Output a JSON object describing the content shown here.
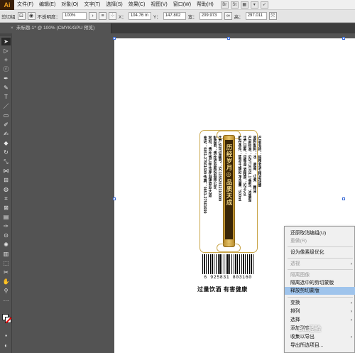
{
  "app": {
    "logo": "Ai"
  },
  "menubar": {
    "items": [
      "文件(F)",
      "编辑(E)",
      "对象(O)",
      "文字(T)",
      "选择(S)",
      "效果(C)",
      "视图(V)",
      "窗口(W)",
      "帮助(H)"
    ],
    "br_label": "Br",
    "st_label": "St"
  },
  "control": {
    "selection_label": "剪切组",
    "opacity_label": "不透明度：",
    "opacity_value": "100%",
    "x_label": "X：",
    "x_value": "104.76 m",
    "y_label": "Y：",
    "y_value": "147.802",
    "w_label": "宽：",
    "w_value": "209.973",
    "h_label": "高：",
    "h_value": "297.011"
  },
  "document": {
    "tab_label": "未标题-1* @ 100% (CMYK/GPU 预览)",
    "close": "×"
  },
  "artwork": {
    "ribbon_text": "历经岁月◎品质天成",
    "columns": [
      "产品名称：纯粮老酒·精品佳酿",
      "原料配料：水、高粱、小麦、糯米",
      "产品标准：GB/T10781.1 香型：浓香型",
      "生产日期：见瓶身 酒精度：52%vol",
      "贮存条件：阴凉干燥处 净含量：500ml",
      "生产许可证编号：SC11552032110099",
      "制造商：贵州酒业股份有限公司",
      "地址：贵州省仁怀市茅台镇酒业大道",
      "电话：0851-27561699 传真：0851-27561699"
    ],
    "barcode_number": "6 925831 803160",
    "warning": "过量饮酒  有害健康"
  },
  "context_menu": {
    "items": [
      {
        "label": "还原取消编组(U)",
        "enabled": true,
        "submenu": false
      },
      {
        "label": "重做(R)",
        "enabled": false,
        "submenu": false
      },
      {
        "label": "设为像素级优化",
        "enabled": true,
        "submenu": false
      },
      {
        "label": "透视",
        "enabled": false,
        "submenu": true
      },
      {
        "label": "隔离图像",
        "enabled": false,
        "submenu": false
      },
      {
        "label": "隔离选中的剪切蒙版",
        "enabled": true,
        "submenu": false
      },
      {
        "label": "释放剪切蒙版",
        "enabled": true,
        "submenu": false,
        "highlighted": true
      },
      {
        "label": "变换",
        "enabled": true,
        "submenu": true
      },
      {
        "label": "排列",
        "enabled": true,
        "submenu": true
      },
      {
        "label": "选择",
        "enabled": true,
        "submenu": true
      },
      {
        "label": "添加到库",
        "enabled": true,
        "submenu": false
      },
      {
        "label": "收集以导出",
        "enabled": true,
        "submenu": true
      },
      {
        "label": "导出所选项目...",
        "enabled": true,
        "submenu": false
      }
    ],
    "submenu_arrow": "›"
  },
  "watermark": "Bai经验",
  "colors": {
    "ui_dark": "#535353",
    "highlight": "#9fc4ec",
    "gold": "#c9a64a",
    "ribbon_dark": "#3a2606",
    "selection_blue": "#3b6bd6"
  }
}
